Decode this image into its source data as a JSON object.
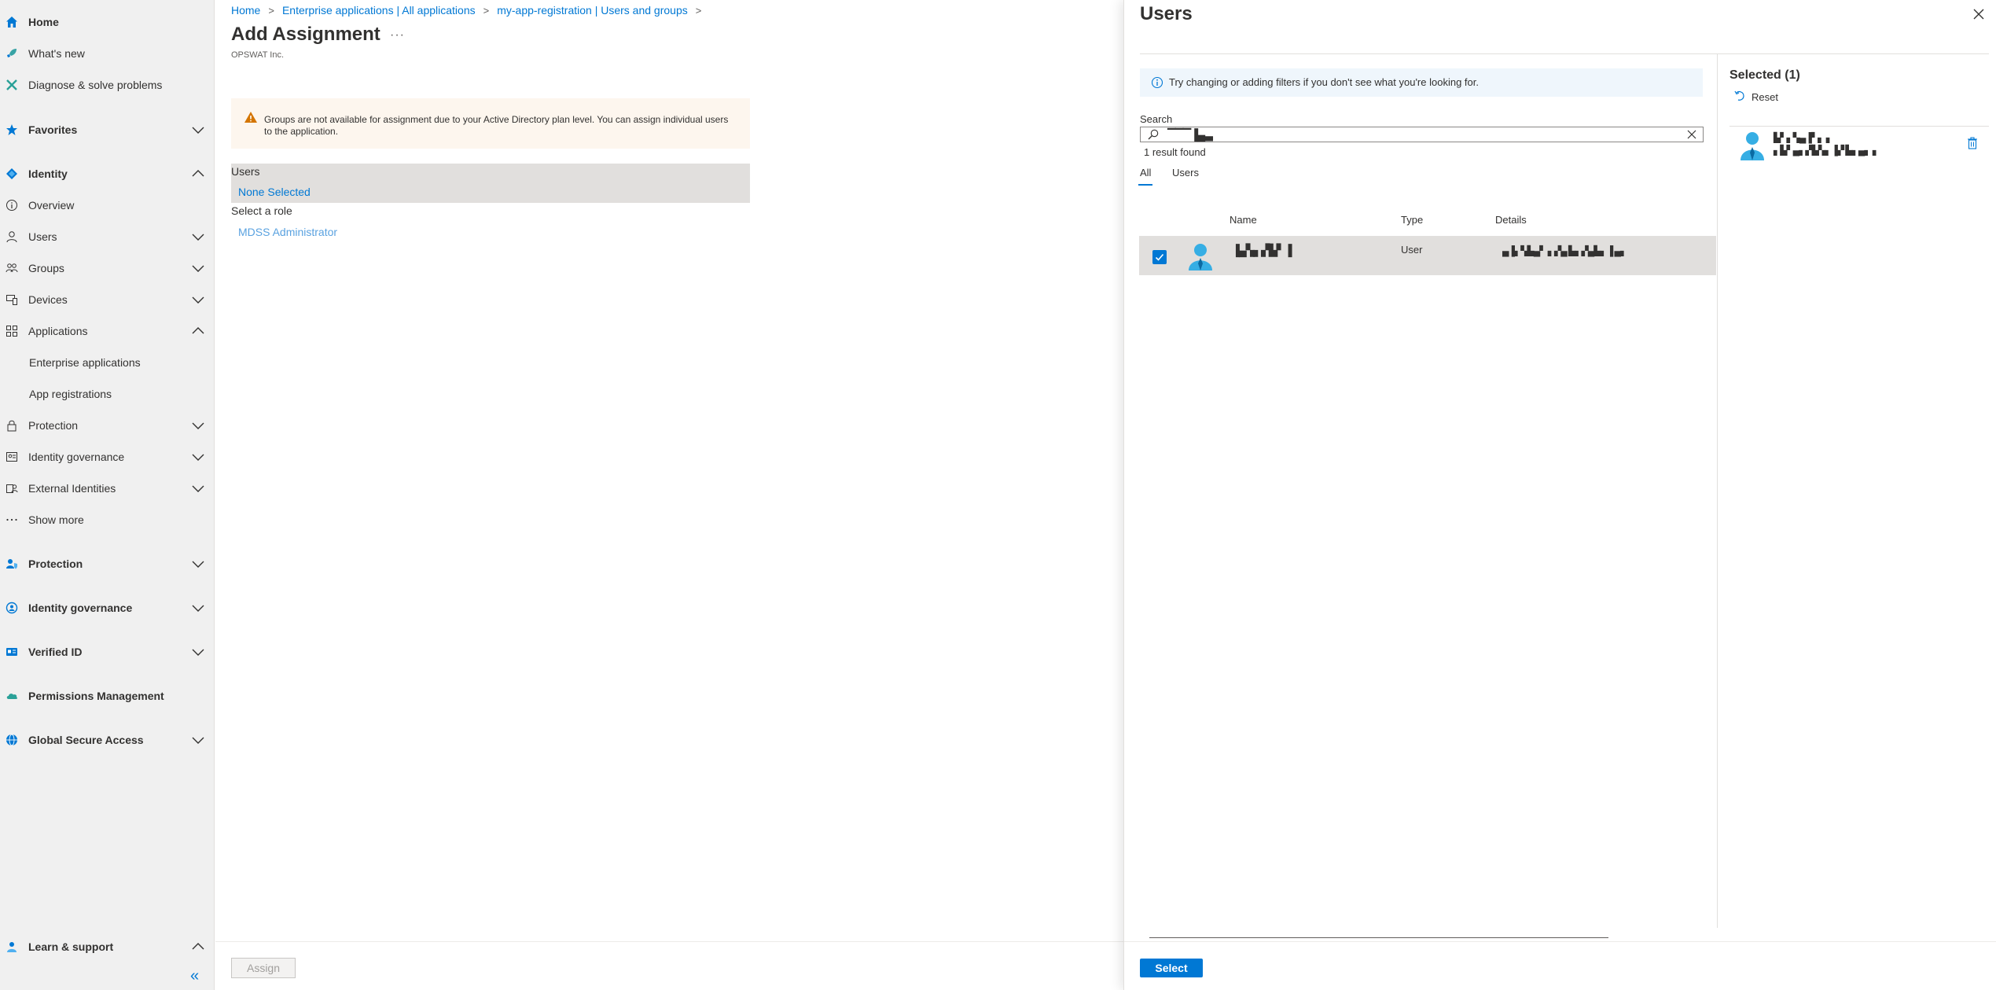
{
  "sidebar": {
    "items": [
      {
        "label": "Home",
        "icon": "home-icon"
      },
      {
        "label": "What's new",
        "icon": "rocket-icon"
      },
      {
        "label": "Diagnose & solve problems",
        "icon": "wrench-icon"
      },
      {
        "label": "Favorites",
        "icon": "star-icon"
      },
      {
        "label": "Identity",
        "icon": "diamond-icon"
      },
      {
        "label": "Overview",
        "icon": "info-icon"
      },
      {
        "label": "Users",
        "icon": "person-icon"
      },
      {
        "label": "Groups",
        "icon": "group-icon"
      },
      {
        "label": "Devices",
        "icon": "devices-icon"
      },
      {
        "label": "Applications",
        "icon": "apps-icon"
      },
      {
        "label": "Enterprise applications"
      },
      {
        "label": "App registrations"
      },
      {
        "label": "Protection",
        "icon": "lock-icon"
      },
      {
        "label": "Identity governance",
        "icon": "governance-icon"
      },
      {
        "label": "External Identities",
        "icon": "external-icon"
      },
      {
        "label": "Show more",
        "icon": "ellipsis-icon"
      },
      {
        "label": "Protection",
        "icon": "protection-icon"
      },
      {
        "label": "Identity governance",
        "icon": "governance-icon"
      },
      {
        "label": "Verified ID",
        "icon": "id-card-icon"
      },
      {
        "label": "Permissions Management",
        "icon": "cloud-icon"
      },
      {
        "label": "Global Secure Access",
        "icon": "globe-icon"
      },
      {
        "label": "Learn & support",
        "icon": "person-support-icon"
      }
    ],
    "collapse_glyph": "«"
  },
  "main": {
    "breadcrumbs": [
      "Home",
      "Enterprise applications | All applications",
      "my-app-registration | Users and groups"
    ],
    "breadcrumb_sep": ">",
    "title": "Add Assignment",
    "more": "···",
    "tenant": "OPSWAT Inc.",
    "warning": "Groups are not available for assignment due to your Active Directory plan level. You can assign individual users to the application.",
    "users_label": "Users",
    "users_value": "None Selected",
    "role_label": "Select a role",
    "role_value": "MDSS Administrator",
    "assign_button": "Assign"
  },
  "panel": {
    "title": "Users",
    "info": "Try changing or adding filters if you don't see what you're looking for.",
    "search_label": "Search",
    "search_value": "▔▔▔▐▄▃",
    "result_count": "1 result found",
    "tabs": [
      "All",
      "Users"
    ],
    "columns": [
      "Name",
      "Type",
      "Details"
    ],
    "result": {
      "name": "▐▄▚▖▞▙▘▐",
      "type": "User",
      "details": "▄▐▖▚▙▄▘ ▖▞▄ ▙▖▞▄▙▖▐ ▄▖"
    },
    "selected_title": "Selected (1)",
    "reset_label": "Reset",
    "selected_item": {
      "name": "▙▘▖▚▄▐▘▖ ▖",
      "detail": "▖▙▘▄▖▞▙▚▖▐▞ ▙▖▄▖ ▖"
    },
    "select_button": "Select"
  },
  "colors": {
    "accent": "#0078d4",
    "sidebar_bg": "#f0f0f0",
    "warning_bg": "#fdf6ee",
    "info_bg": "#eff6fc",
    "warning_icon": "#d47500"
  }
}
